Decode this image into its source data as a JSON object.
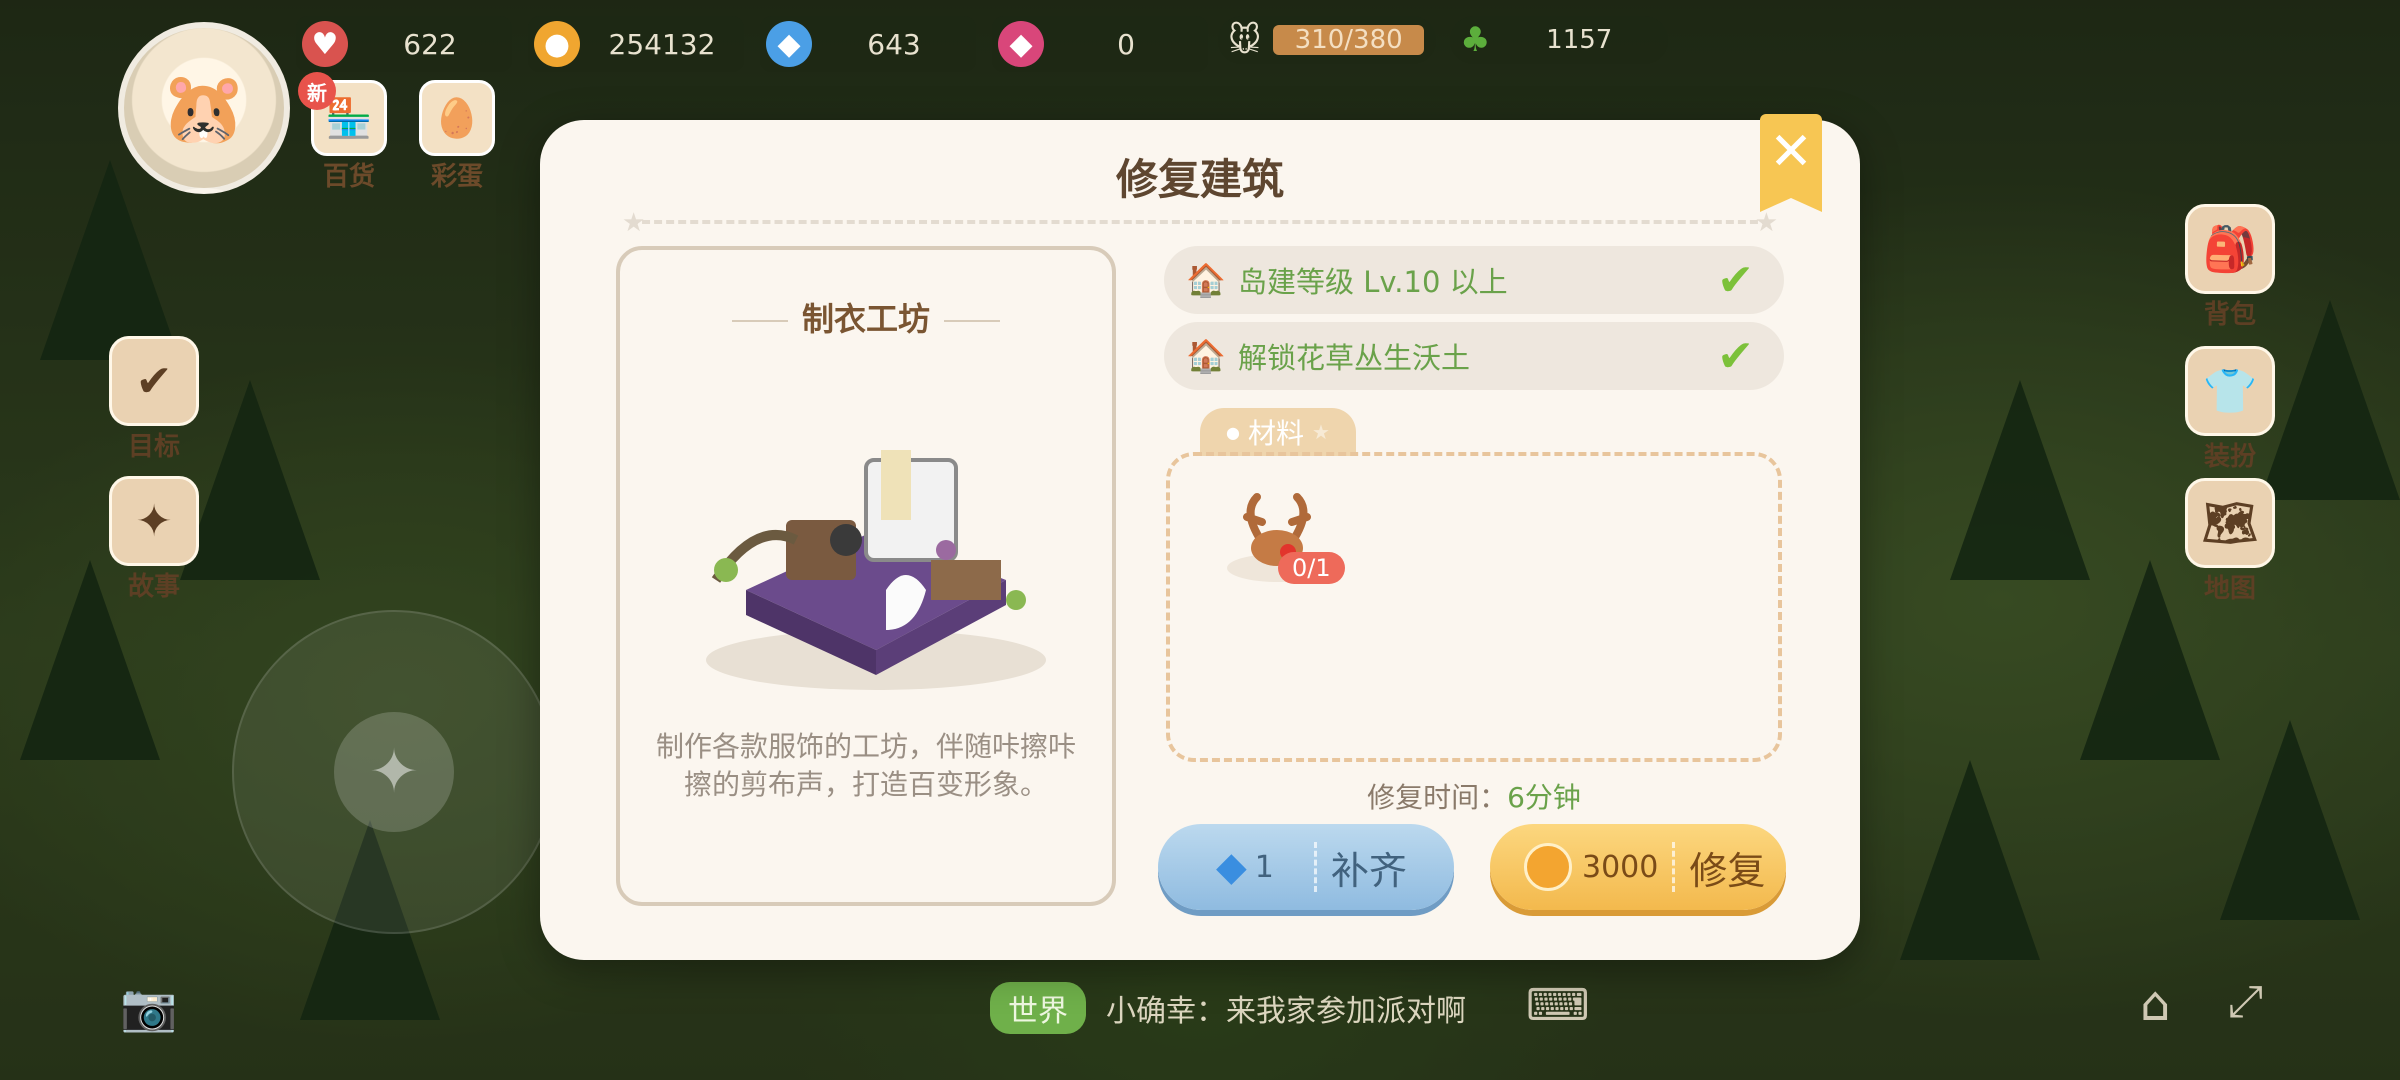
{
  "hud": {
    "resources": [
      {
        "icon": "heart-plus-icon",
        "value": "622"
      },
      {
        "icon": "coin-icon",
        "value": "254132"
      },
      {
        "icon": "gem-plus-icon",
        "value": "643"
      },
      {
        "icon": "ruby-plus-icon",
        "value": "0"
      }
    ],
    "energy": "310/380",
    "clover": "1157"
  },
  "top_buttons": [
    {
      "label": "百货",
      "icon": "shop-icon",
      "badge": "新"
    },
    {
      "label": "彩蛋",
      "icon": "egg-icon",
      "badge": ""
    }
  ],
  "side_left": [
    {
      "label": "目标",
      "icon": "target-checklist-icon"
    },
    {
      "label": "故事",
      "icon": "story-book-icon"
    }
  ],
  "side_right": [
    {
      "label": "背包",
      "icon": "backpack-icon"
    },
    {
      "label": "装扮",
      "icon": "outfit-icon"
    },
    {
      "label": "地图",
      "icon": "map-icon"
    }
  ],
  "chat": {
    "channel": "世界",
    "message": "小确幸：来我家参加派对啊"
  },
  "dialog": {
    "title": "修复建筑",
    "close_label": "✕",
    "building": {
      "name": "制衣工坊",
      "description": "制作各款服饰的工坊，伴随咔擦咔擦的剪布声，打造百变形象。"
    },
    "requirements": [
      {
        "icon": "island-house-icon",
        "text": "岛建等级 Lv.10 以上",
        "met": true
      },
      {
        "icon": "unlock-house-icon",
        "text": "解锁花草丛生沃土",
        "met": true
      }
    ],
    "materials_tab": "材料",
    "materials": [
      {
        "icon": "reindeer-antler-icon",
        "count": "0/1"
      }
    ],
    "repair_time_label": "修复时间：",
    "repair_time_value": "6分钟",
    "fill_button": {
      "cost": "1",
      "label": "补齐"
    },
    "repair_button": {
      "cost": "3000",
      "label": "修复"
    }
  }
}
